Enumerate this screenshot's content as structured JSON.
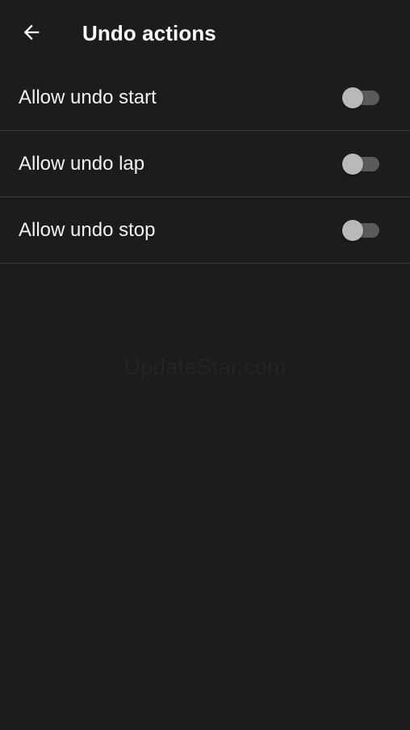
{
  "app_bar": {
    "back_icon": "arrow-left-icon",
    "title": "Undo actions"
  },
  "settings": [
    {
      "label": "Allow undo start",
      "enabled": false
    },
    {
      "label": "Allow undo lap",
      "enabled": false
    },
    {
      "label": "Allow undo stop",
      "enabled": false
    }
  ],
  "watermark": "UpdateStar.com",
  "colors": {
    "background": "#1b1c1c",
    "divider": "#3a3b3b",
    "toggle_track_off": "#5a5b5b",
    "toggle_thumb_off": "#b9b9b9",
    "text": "#ffffff"
  }
}
